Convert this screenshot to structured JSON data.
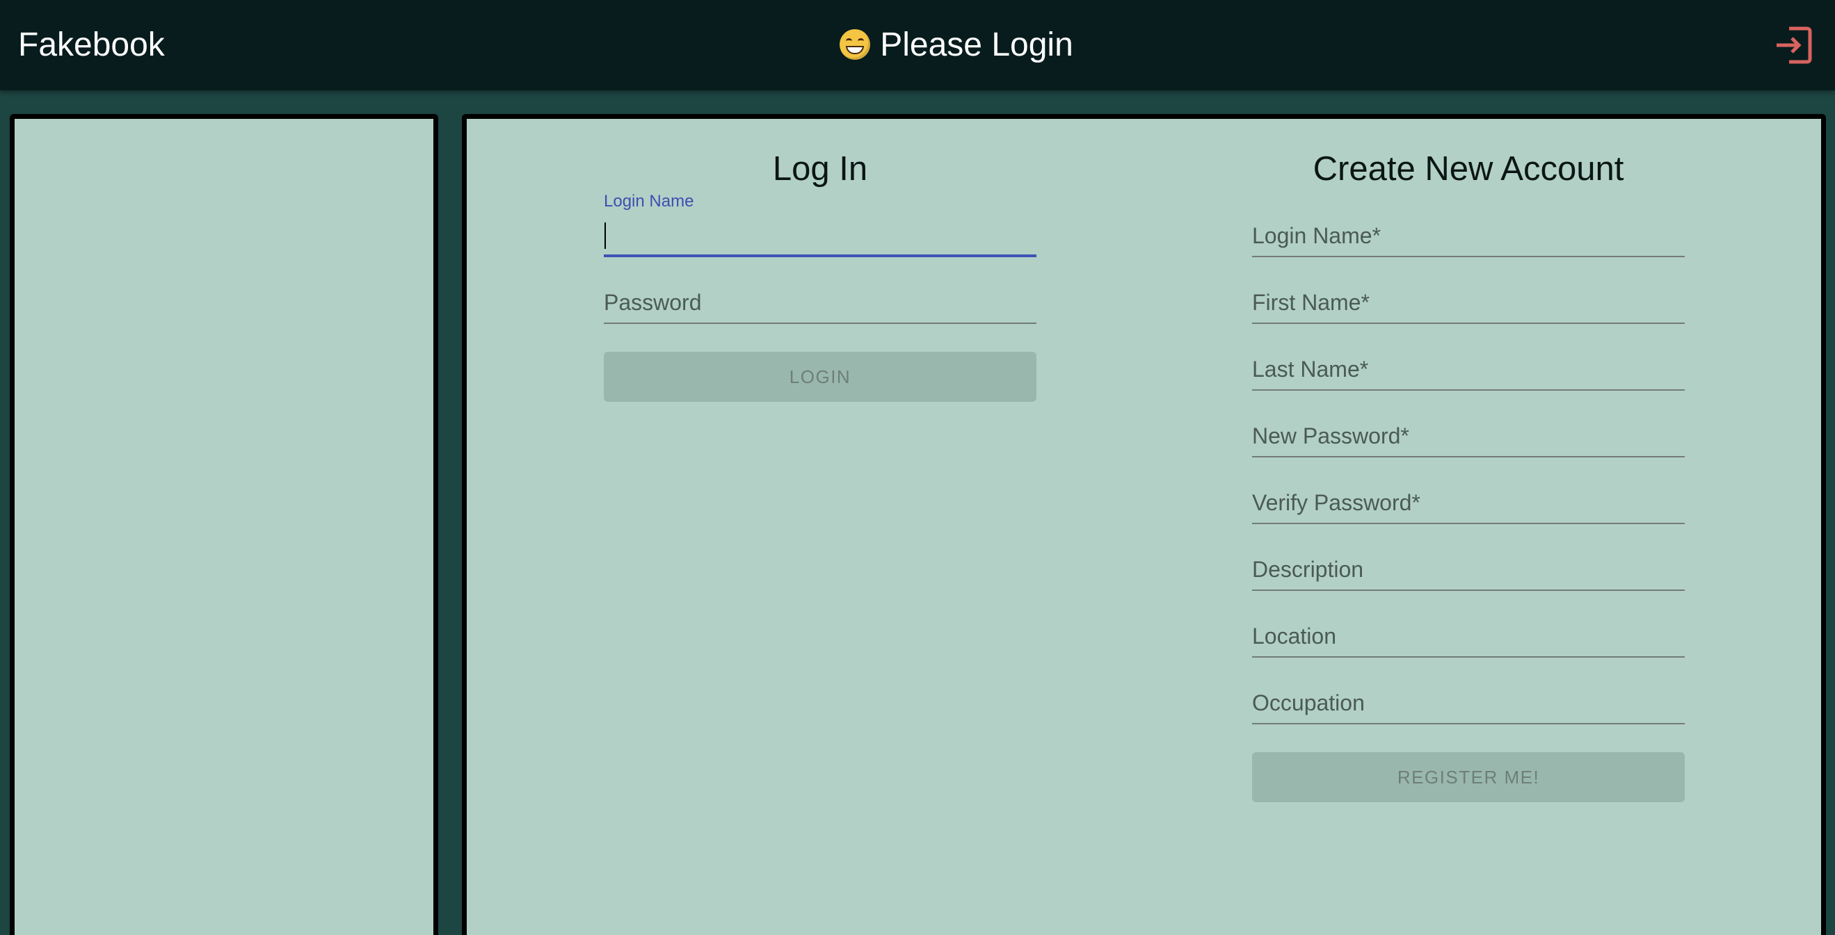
{
  "appbar": {
    "brand": "Fakebook",
    "title": "Please Login",
    "title_emoji": "grinning-face",
    "logout_icon": "login-exit-icon"
  },
  "colors": {
    "appbar_bg": "#081c1e",
    "page_bg": "#1d4541",
    "panel_bg": "#b2d0c6",
    "accent": "#3f51b5",
    "logout_icon": "#d9635e",
    "disabled_button_bg": "#9ab7ae"
  },
  "login": {
    "heading": "Log In",
    "login_name": {
      "label": "Login Name",
      "value": ""
    },
    "password": {
      "label": "Password",
      "value": ""
    },
    "button_label": "LOGIN"
  },
  "register": {
    "heading": "Create New Account",
    "fields": [
      {
        "label": "Login Name*",
        "value": ""
      },
      {
        "label": "First Name*",
        "value": ""
      },
      {
        "label": "Last Name*",
        "value": ""
      },
      {
        "label": "New Password*",
        "value": ""
      },
      {
        "label": "Verify Password*",
        "value": ""
      },
      {
        "label": "Description",
        "value": ""
      },
      {
        "label": "Location",
        "value": ""
      },
      {
        "label": "Occupation",
        "value": ""
      }
    ],
    "button_label": "REGISTER ME!"
  }
}
